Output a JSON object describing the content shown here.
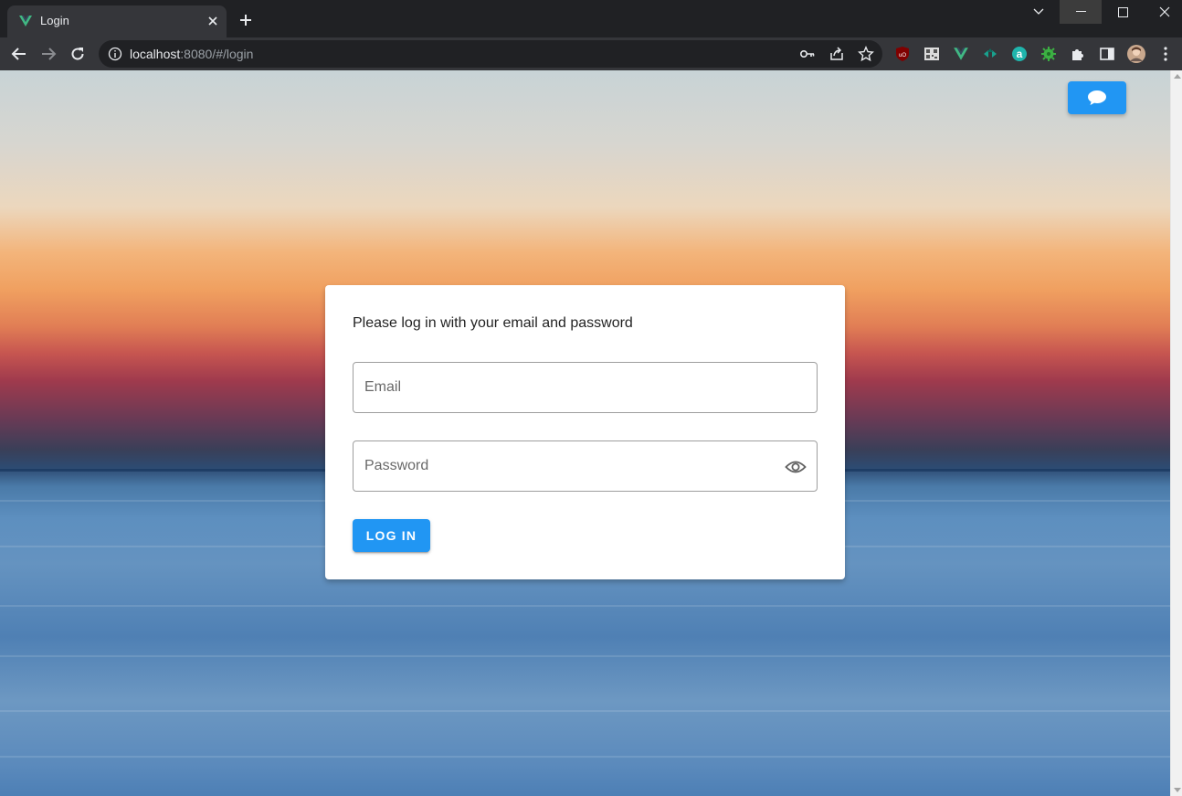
{
  "browser": {
    "tab": {
      "title": "Login",
      "favicon": "vue-logo-icon"
    },
    "url": {
      "host": "localhost",
      "rest": ":8080/#/login"
    },
    "extensions": [
      "ublock-icon",
      "qr-icon",
      "vue-devtools-icon",
      "arrow-ext-icon",
      "a-ext-icon",
      "bug-ext-icon",
      "puzzle-icon",
      "sidepanel-icon",
      "profile-avatar",
      "kebab-menu-icon"
    ]
  },
  "page": {
    "chat_button_icon": "chat-bubble-icon",
    "login_card": {
      "title": "Please log in with your email and password",
      "email_placeholder": "Email",
      "password_placeholder": "Password",
      "login_label": "LOG IN"
    }
  },
  "colors": {
    "primary": "#2196f3",
    "chrome_dark": "#202124",
    "chrome_toolbar": "#35363a"
  }
}
